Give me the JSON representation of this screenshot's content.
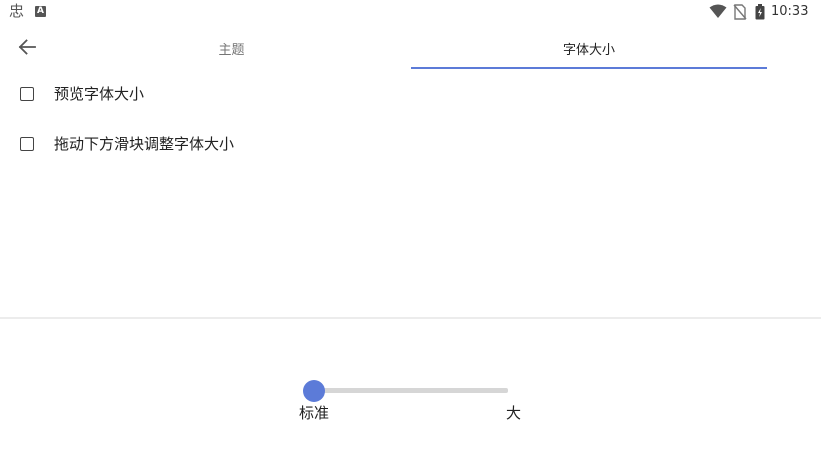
{
  "status_bar": {
    "time": "10:33",
    "left_icons": [
      "app-notification-icon",
      "a-letter-icon"
    ],
    "right_icons": [
      "wifi-icon",
      "no-sim-icon",
      "battery-charging-icon"
    ]
  },
  "header": {
    "back_icon": "arrow-left-icon",
    "tabs": [
      {
        "label": "主题",
        "selected": false
      },
      {
        "label": "字体大小",
        "selected": true
      }
    ],
    "accent_color": "#5c7bd8"
  },
  "options": [
    {
      "label": "预览字体大小",
      "checked": false
    },
    {
      "label": "拖动下方滑块调整字体大小",
      "checked": false
    }
  ],
  "slider": {
    "min_label": "标准",
    "max_label": "大",
    "value_fraction": 0.0,
    "thumb_color": "#5c7bd8"
  }
}
